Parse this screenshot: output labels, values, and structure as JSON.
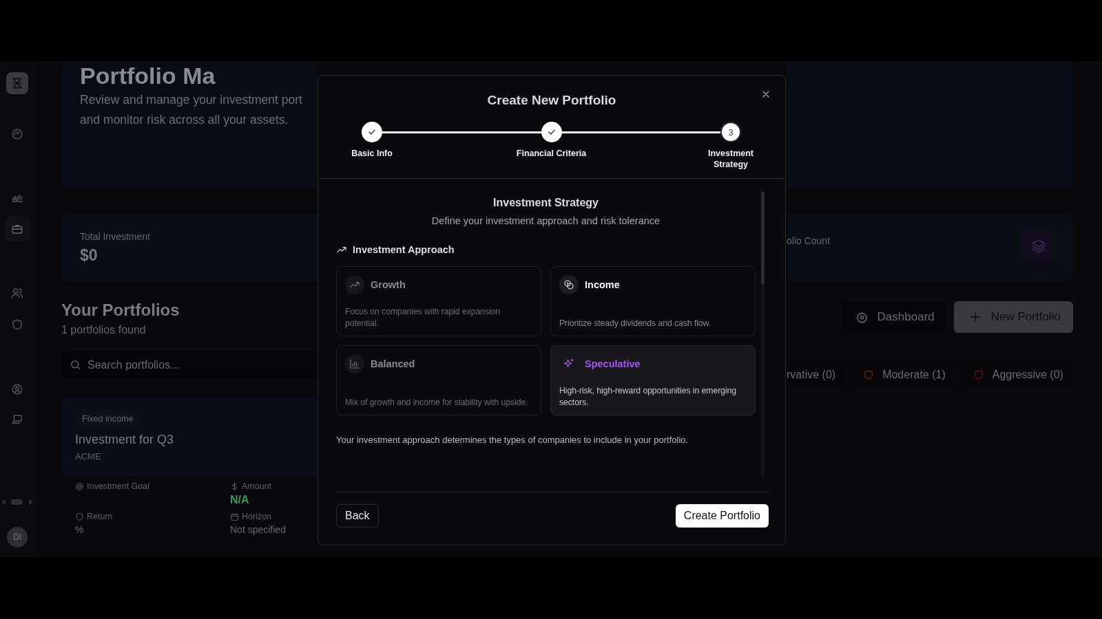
{
  "sidebar": {
    "items": [
      {
        "kind": "gauge",
        "selected": false
      },
      {
        "kind": "chart",
        "selected": false
      },
      {
        "kind": "briefcase",
        "selected": true
      },
      {
        "kind": "users",
        "selected": false
      },
      {
        "kind": "shield",
        "selected": false
      },
      {
        "kind": "user-circle",
        "selected": false
      },
      {
        "kind": "laptop",
        "selected": false
      }
    ],
    "avatar": {
      "initials": "DI"
    }
  },
  "header": {
    "title": "Portfolio Ma",
    "subtitle_lines": [
      "Review and manage your investment port",
      "and monitor risk across all your assets."
    ]
  },
  "stats": [
    {
      "label": "Total Investment",
      "value": "$0"
    },
    {
      "label": "olio Count"
    }
  ],
  "portfolios": {
    "title": "Your Portfolios",
    "count": "1 portfolios found",
    "search": {
      "placeholder": "Search portfolios..."
    },
    "buttons": [
      {
        "label": "Dashboard",
        "kind": "secondary"
      },
      {
        "label": "New Portfolio",
        "kind": "primary"
      }
    ],
    "filters": [
      {
        "label": "rvative (0)"
      },
      {
        "label": "Moderate (1)",
        "color": "#4a2a14"
      },
      {
        "label": "Aggressive (0)",
        "color": "#4a1616"
      }
    ],
    "card": {
      "tag": "Fixed income",
      "title": "Investment for Q3",
      "company": "ACME",
      "fields": [
        {
          "kind": "goal",
          "label": "Investment Goal"
        },
        {
          "kind": "amount",
          "label": "Amount",
          "value": "N/A"
        },
        {
          "kind": "return",
          "label": "Return",
          "value": "%"
        },
        {
          "kind": "horizon",
          "label": "Horizon",
          "value": "Not specified"
        }
      ]
    }
  },
  "modal": {
    "title": "Create New Portfolio",
    "steps": [
      {
        "label": "Basic Info",
        "completed": true
      },
      {
        "label": "Financial Criteria",
        "completed": true
      },
      {
        "label": "Investment Strategy",
        "completed": false,
        "number": "3"
      }
    ],
    "section_title": "Investment Strategy",
    "section_subtitle": "Define your investment approach and risk tolerance",
    "approach_label": "Investment Approach",
    "options": [
      {
        "kind": "growth",
        "title": "Growth",
        "description": "Focus on companies with rapid expansion potential.",
        "selected": false,
        "hovered": false
      },
      {
        "kind": "income",
        "title": "Income",
        "description": "Prioritize steady dividends and cash flow.",
        "selected": false,
        "hovered": true
      },
      {
        "kind": "balanced",
        "title": "Balanced",
        "description": "Mix of growth and income for stability with upside.",
        "selected": false,
        "hovered": false
      },
      {
        "kind": "speculative",
        "title": "Speculative",
        "description": "High-risk, high-reward opportunities in emerging sectors.",
        "selected": true,
        "hovered": false
      }
    ],
    "note": "Your investment approach determines the types of companies to include in your portfolio.",
    "back": "Back",
    "create": "Create Portfolio"
  }
}
